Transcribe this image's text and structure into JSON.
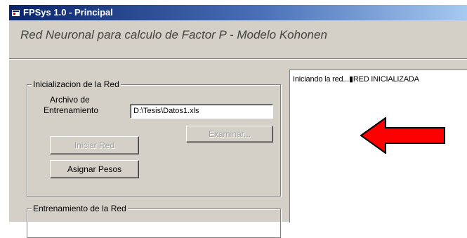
{
  "window": {
    "title": "FPSys 1.0 - Principal",
    "icon": "app-icon"
  },
  "header": {
    "text": "Red Neuronal para calculo de Factor P - Modelo Kohonen"
  },
  "init_group": {
    "title": "Inicializacion de la Red",
    "file_label_line1": "Archivo de",
    "file_label_line2": "Entrenamiento",
    "file_value": "D:\\Tesis\\Datos1.xls",
    "browse_label": "Examinar...",
    "start_label": "Iniciar Red",
    "weights_label": "Asignar Pesos"
  },
  "train_group": {
    "title": "Entrenamiento de la Red"
  },
  "output": {
    "text": "Iniciando la red...▮RED INICIALIZADA"
  },
  "annotation": {
    "icon": "red-arrow-icon",
    "color": "#ff0000"
  }
}
